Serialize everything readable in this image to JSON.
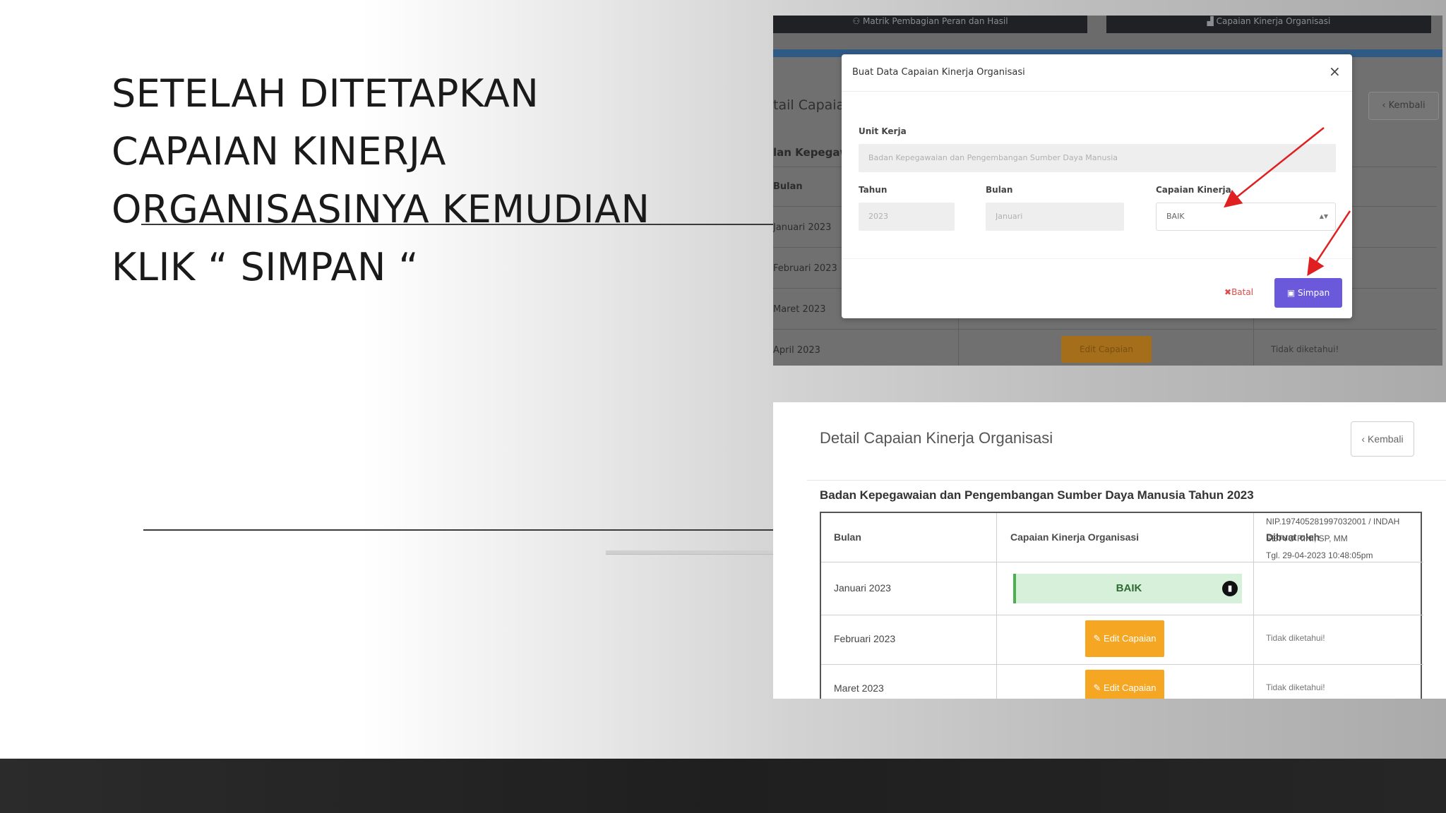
{
  "slide": {
    "headline_lines": [
      "SETELAH DITETAPKAN",
      "CAPAIAN KINERJA",
      "ORGANISASINYA KEMUDIAN",
      "KLIK “ SIMPAN “"
    ]
  },
  "screenshot1": {
    "top_buttons": [
      "Matrik Pembagian Peran dan Hasil",
      "Capaian Kinerja Organisasi"
    ],
    "background": {
      "title": "tail Capaian",
      "subtitle": "lan Kepegawa",
      "kembali": "Kembali",
      "column": "Bulan",
      "rows": [
        "Januari 2023",
        "Februari 2023",
        "Maret 2023",
        "April 2023"
      ],
      "edit_label": "Edit Capaian",
      "tidak": "Tidak diketahui!"
    },
    "modal": {
      "title": "Buat Data Capaian Kinerja Organisasi",
      "close": "×",
      "unit_label": "Unit Kerja",
      "unit_value": "Badan Kepegawaian dan Pengembangan Sumber Daya Manusia",
      "tahun_label": "Tahun",
      "tahun_value": "2023",
      "bulan_label": "Bulan",
      "bulan_value": "Januari",
      "capaian_label": "Capaian Kinerja",
      "capaian_value": "BAIK",
      "batal": "Batal",
      "simpan": "Simpan"
    }
  },
  "screenshot2": {
    "title": "Detail Capaian Kinerja Organisasi",
    "kembali": "Kembali",
    "subtitle": "Badan Kepegawaian dan Pengembangan Sumber Daya Manusia Tahun 2023",
    "headers": [
      "Bulan",
      "Capaian Kinerja Organisasi",
      "Dibuat oleh"
    ],
    "rows": [
      {
        "bulan": "Januari 2023",
        "capaian": "BAIK",
        "dibuat": [
          "NIP.197405281997032001 / INDAH",
          "SETYO RINI, SP, MM",
          "Tgl. 29-04-2023 10:48:05pm"
        ]
      },
      {
        "bulan": "Februari 2023",
        "capaian": "Edit Capaian",
        "dibuat": "Tidak diketahui!"
      },
      {
        "bulan": "Maret 2023",
        "capaian": "Edit Capaian",
        "dibuat": "Tidak diketahui!"
      }
    ]
  },
  "colors": {
    "simpan": "#6a5adb",
    "edit": "#f5a623",
    "badge_bg": "#d7f0d9",
    "batal": "#e04a4a"
  }
}
